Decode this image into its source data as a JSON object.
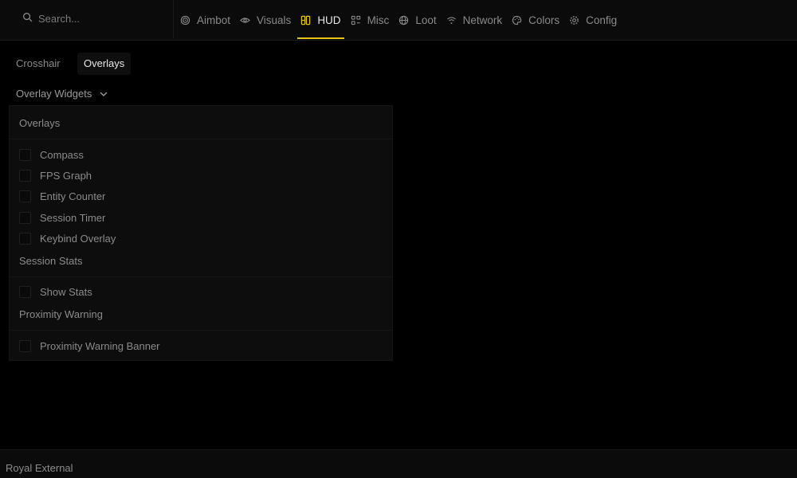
{
  "search": {
    "placeholder": "Search..."
  },
  "nav": {
    "items": [
      {
        "label": "Aimbot",
        "icon": "target-icon"
      },
      {
        "label": "Visuals",
        "icon": "eye-icon"
      },
      {
        "label": "HUD",
        "icon": "hud-icon",
        "active": true
      },
      {
        "label": "Misc",
        "icon": "grid-icon"
      },
      {
        "label": "Loot",
        "icon": "globe-icon"
      },
      {
        "label": "Network",
        "icon": "wifi-icon"
      },
      {
        "label": "Colors",
        "icon": "palette-icon"
      },
      {
        "label": "Config",
        "icon": "gear-icon"
      }
    ]
  },
  "subtabs": {
    "crosshair": "Crosshair",
    "overlays": "Overlays",
    "active": "Overlays"
  },
  "dropdown": {
    "label": "Overlay Widgets"
  },
  "panel": {
    "sections": [
      {
        "title": "Overlays",
        "options": [
          {
            "label": "Compass",
            "checked": false
          },
          {
            "label": "FPS Graph",
            "checked": false
          },
          {
            "label": "Entity Counter",
            "checked": false
          },
          {
            "label": "Session Timer",
            "checked": false
          },
          {
            "label": "Keybind Overlay",
            "checked": false
          }
        ]
      },
      {
        "title": "Session Stats",
        "options": [
          {
            "label": "Show Stats",
            "checked": false
          }
        ]
      },
      {
        "title": "Proximity Warning",
        "options": [
          {
            "label": "Proximity Warning Banner",
            "checked": false
          }
        ]
      }
    ]
  },
  "footer": {
    "title": "Royal External"
  },
  "colors": {
    "accent": "#e6c317",
    "background": "#000000",
    "panel": "#0d0d0d"
  }
}
